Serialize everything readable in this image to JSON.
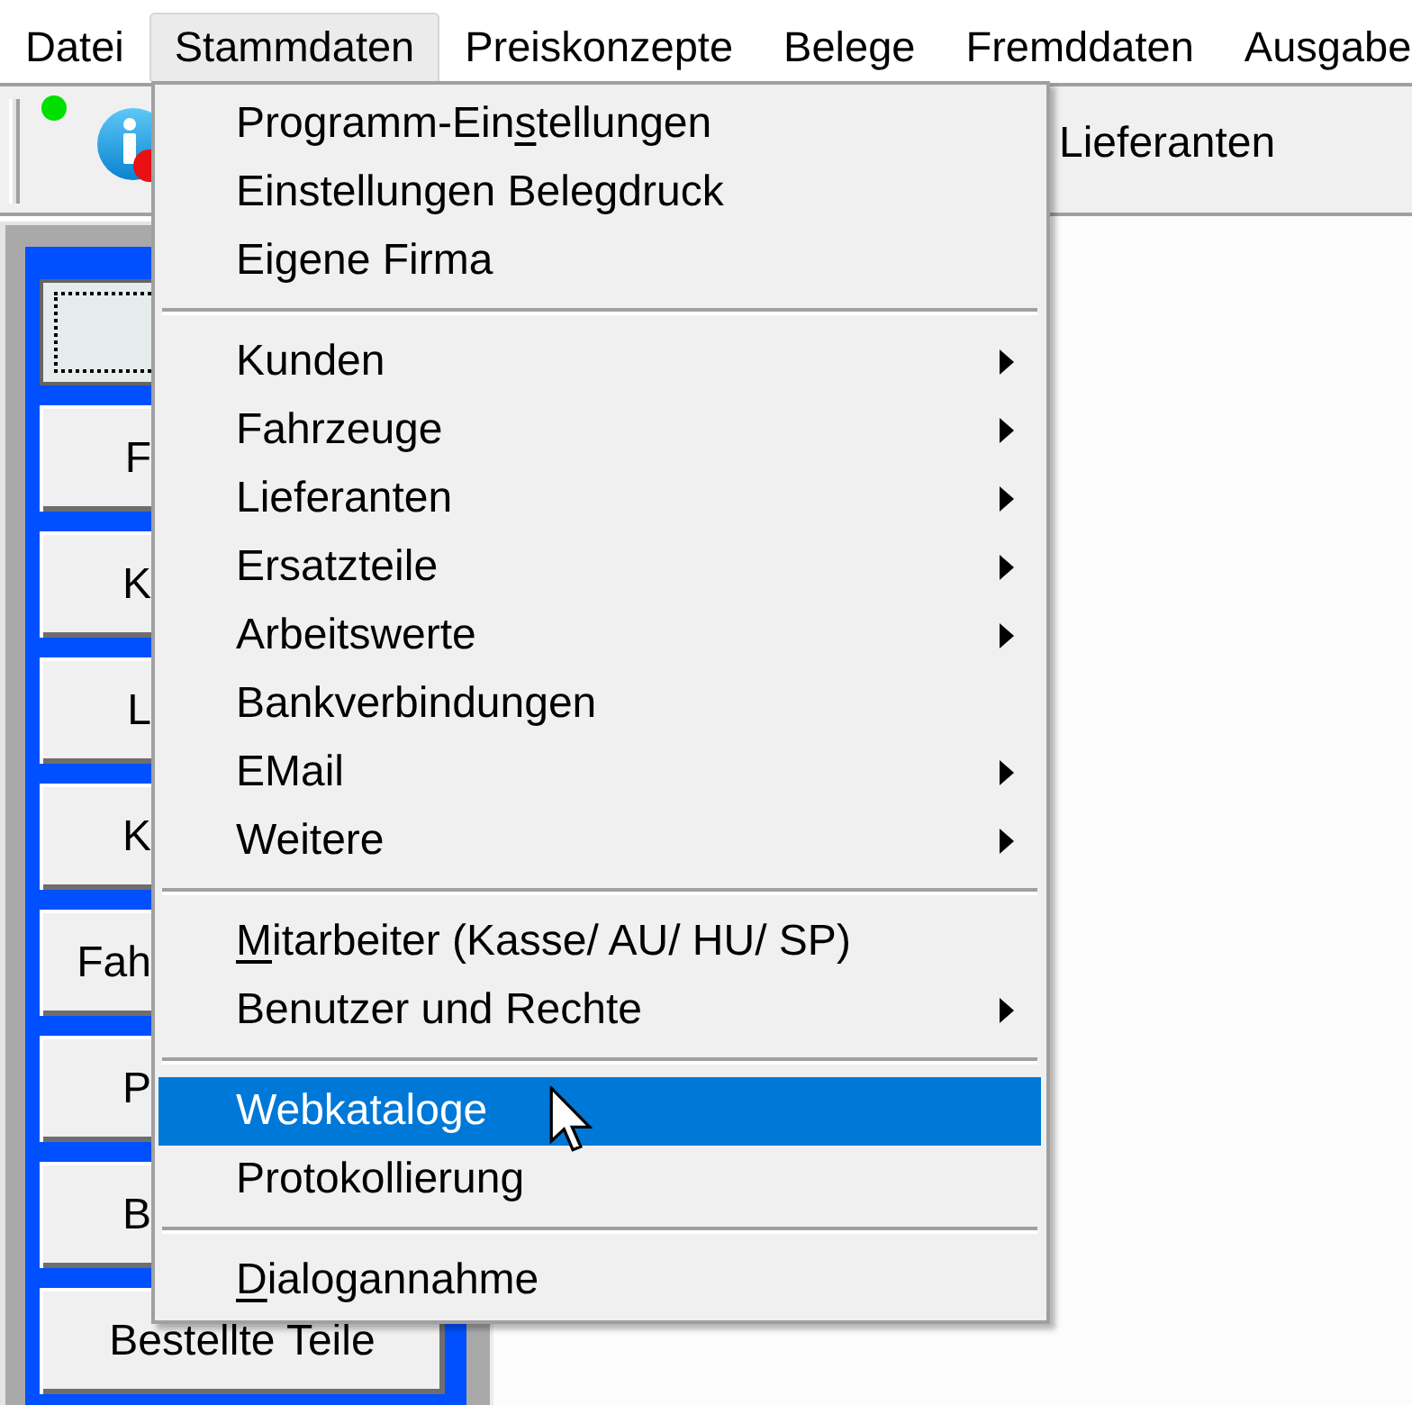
{
  "menu_bar": {
    "items": [
      {
        "label": "Datei",
        "selected": false
      },
      {
        "label": "Stammdaten",
        "selected": true
      },
      {
        "label": "Preiskonzepte",
        "selected": false
      },
      {
        "label": "Belege",
        "selected": false
      },
      {
        "label": "Fremddaten",
        "selected": false
      },
      {
        "label": "Ausgabe",
        "selected": false
      }
    ]
  },
  "toolbar": {
    "buttons": [
      {
        "label": "Lieferanten"
      }
    ]
  },
  "side_panel": {
    "buttons": [
      {
        "focused": true
      },
      {
        "label": "F",
        "focused": false
      },
      {
        "label": "K",
        "focused": false
      },
      {
        "label": "L",
        "focused": false
      },
      {
        "label": "K",
        "focused": false
      },
      {
        "label": "Fah",
        "focused": false
      },
      {
        "label": "P",
        "focused": false
      },
      {
        "label": "B",
        "focused": false
      },
      {
        "label": "Bestellte Teile",
        "focused": false
      }
    ]
  },
  "dropdown": {
    "items": [
      {
        "kind": "command",
        "label": "Programm-Ein",
        "access_key": "s",
        "label_end": "tellungen",
        "submenu": false,
        "selected": false
      },
      {
        "kind": "command",
        "label": "Einstellungen Belegdruck",
        "submenu": false,
        "selected": false
      },
      {
        "kind": "command",
        "label": "Eigene Firma",
        "submenu": false,
        "selected": false
      },
      {
        "kind": "separator"
      },
      {
        "kind": "command",
        "label": "Kunden",
        "submenu": true,
        "selected": false
      },
      {
        "kind": "command",
        "label": "Fahrzeuge",
        "submenu": true,
        "selected": false
      },
      {
        "kind": "command",
        "label": "Lieferanten",
        "submenu": true,
        "selected": false
      },
      {
        "kind": "command",
        "label": "Ersatzteile",
        "submenu": true,
        "selected": false
      },
      {
        "kind": "command",
        "label": "Arbeitswerte",
        "submenu": true,
        "selected": false
      },
      {
        "kind": "command",
        "label": "Bankverbindungen",
        "submenu": false,
        "selected": false
      },
      {
        "kind": "command",
        "label": "EMail",
        "submenu": true,
        "selected": false
      },
      {
        "kind": "command",
        "label": "Weitere",
        "submenu": true,
        "selected": false
      },
      {
        "kind": "separator"
      },
      {
        "kind": "command",
        "access_key": "M",
        "label_end": "itarbeiter (Kasse/ AU/ HU/ SP)",
        "submenu": false,
        "selected": false
      },
      {
        "kind": "command",
        "label": "Benutzer und Rechte",
        "submenu": true,
        "selected": false
      },
      {
        "kind": "separator"
      },
      {
        "kind": "command",
        "label": "Webkataloge",
        "submenu": false,
        "selected": true
      },
      {
        "kind": "command",
        "label": "Protokollierung",
        "submenu": false,
        "selected": false
      },
      {
        "kind": "separator"
      },
      {
        "kind": "command",
        "access_key": "D",
        "label_end": "ialogannahme",
        "submenu": false,
        "selected": false
      }
    ]
  }
}
